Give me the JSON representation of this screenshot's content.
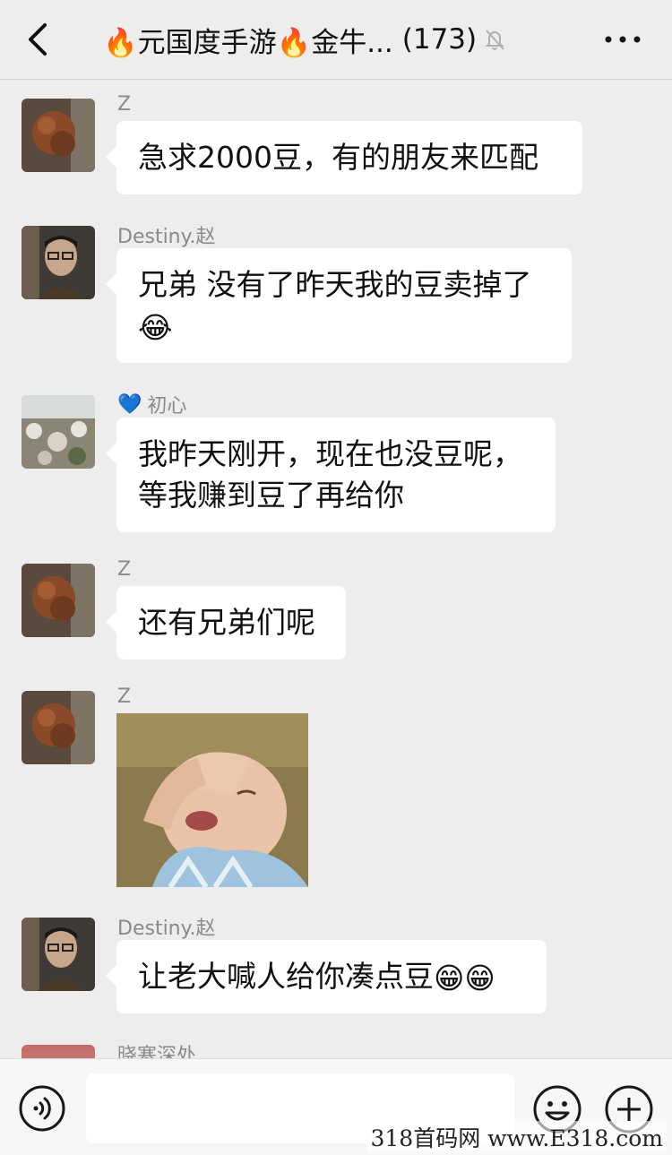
{
  "header": {
    "title": "🔥元国度手游🔥金牛...",
    "count": "(173)",
    "back_icon": "chevron-left-icon",
    "mute_icon": "bell-off-icon",
    "more_icon": "more-horizontal-icon"
  },
  "messages": [
    {
      "sender": "Z",
      "text": "急求2000豆，有的朋友来匹配",
      "avatar": "dog-avatar"
    },
    {
      "sender": "Destiny.赵",
      "text": "兄弟 没有了昨天我的豆卖掉了",
      "emoji": "😂",
      "avatar": "man-glasses-avatar"
    },
    {
      "sender_emoji": "💙",
      "sender": "初心",
      "text_lines": [
        "我昨天刚开，现在也没豆呢，",
        "等我赚到豆了再给你"
      ],
      "avatar": "flowers-avatar"
    },
    {
      "sender": "Z",
      "text": "还有兄弟们呢",
      "avatar": "dog-avatar"
    },
    {
      "sender": "Z",
      "sticker": "crying-baby-sticker",
      "avatar": "dog-avatar"
    },
    {
      "sender": "Destiny.赵",
      "text": "让老大喊人给你凑点豆",
      "emoji": "😁😁",
      "avatar": "man-glasses-avatar"
    },
    {
      "sender": "晓寒深处",
      "avatar": "sunset-avatar"
    }
  ],
  "input": {
    "voice_icon": "voice-icon",
    "emoji_icon": "smiley-icon",
    "plus_icon": "plus-circle-icon"
  },
  "watermark": "318首码网 www.E318.com",
  "colors": {
    "background": "#ededed",
    "bubble": "#ffffff",
    "sender": "#8a8a8a"
  }
}
